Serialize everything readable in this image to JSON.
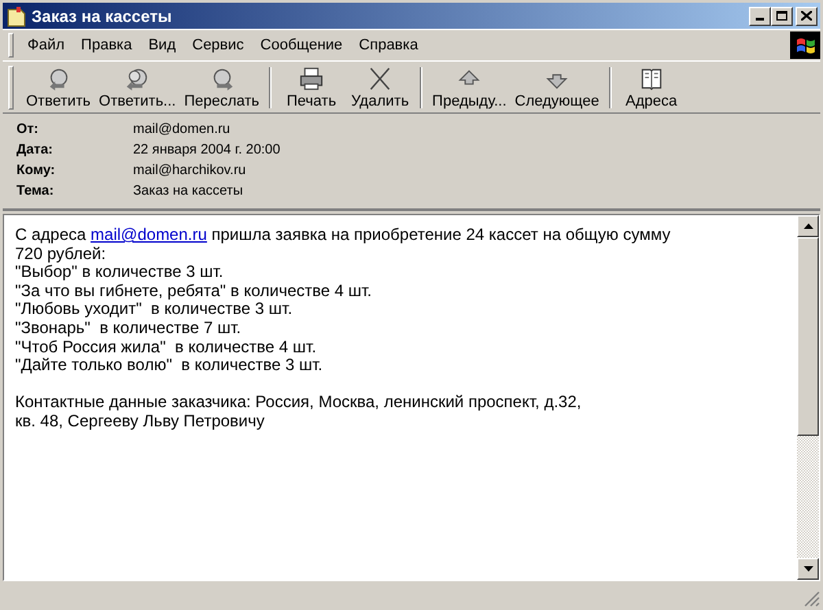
{
  "window": {
    "title": "Заказ на кассеты"
  },
  "menu": [
    "Файл",
    "Правка",
    "Вид",
    "Сервис",
    "Сообщение",
    "Справка"
  ],
  "toolbar_groups": [
    [
      {
        "label": "Ответить",
        "kind": "reply"
      },
      {
        "label": "Ответить...",
        "kind": "reply-all"
      },
      {
        "label": "Переслать",
        "kind": "forward"
      }
    ],
    [
      {
        "label": "Печать",
        "kind": "print"
      },
      {
        "label": "Удалить",
        "kind": "delete"
      }
    ],
    [
      {
        "label": "Предыду...",
        "kind": "previous"
      },
      {
        "label": "Следующее",
        "kind": "next"
      }
    ],
    [
      {
        "label": "Адреса",
        "kind": "addresses"
      }
    ]
  ],
  "headers": [
    {
      "label": "От:",
      "value": "mail@domen.ru"
    },
    {
      "label": "Дата:",
      "value": "22 января 2004 г. 20:00"
    },
    {
      "label": "Кому:",
      "value": "mail@harchikov.ru"
    },
    {
      "label": "Тема:",
      "value": "Заказ на кассеты"
    }
  ],
  "message": {
    "first_line": {
      "before": "С адреса",
      "link": "mail@domen.ru",
      "after": "пришла заявка на приобретение 24 кассет на общую сумму"
    },
    "paragraphs": [
      [
        "720 рублей:",
        "\"Выбор\" в количестве 3 шт.",
        "\"За что вы гибнете, ребята\" в количестве 4 шт.",
        "\"Любовь уходит\"  в количестве 3 шт.",
        "\"Звонарь\"  в количестве 7 шт.",
        "\"Чтоб Россия жила\"  в количестве 4 шт.",
        "\"Дайте только волю\"  в количестве 3 шт."
      ],
      [
        "Контактные данные заказчика: Россия, Москва, ленинский проспект, д.32,",
        "кв. 48, Сергееву Льву Петровичу"
      ]
    ]
  }
}
